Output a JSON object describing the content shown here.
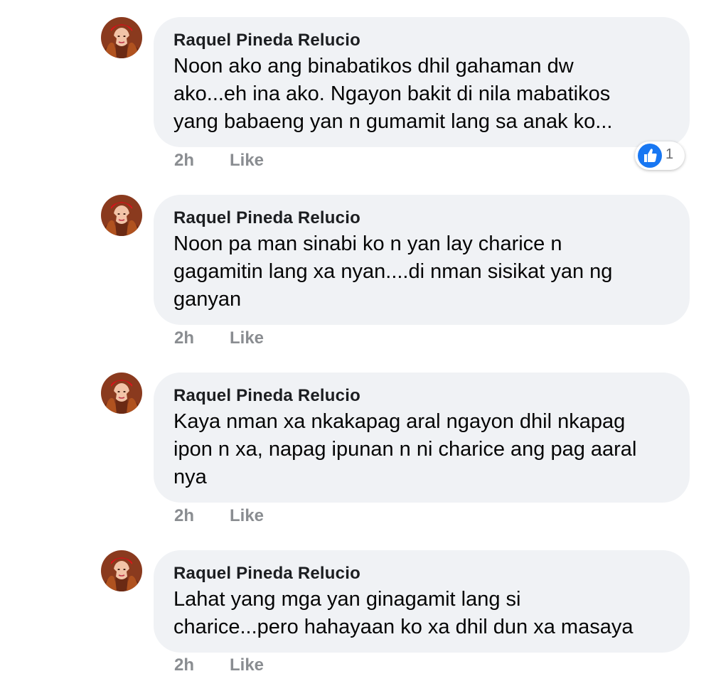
{
  "comments": [
    {
      "author": "Raquel Pineda Relucio",
      "text": "Noon ako ang binabatikos dhil gahaman dw\nako...eh ina ako. Ngayon bakit di nila mabatikos\nyang babaeng yan n gumamit lang sa anak ko...",
      "time": "2h",
      "like_label": "Like",
      "reaction_count": "1"
    },
    {
      "author": "Raquel Pineda Relucio",
      "text": "Noon pa man sinabi ko n yan lay charice n\ngagamitin lang xa nyan....di nman sisikat yan ng\nganyan",
      "time": "2h",
      "like_label": "Like"
    },
    {
      "author": "Raquel Pineda Relucio",
      "text": "Kaya nman xa nkakapag aral ngayon dhil nkapag\nipon n xa, napag ipunan n ni charice ang pag aaral\nnya",
      "time": "2h",
      "like_label": "Like"
    },
    {
      "author": "Raquel Pineda Relucio",
      "text": "Lahat yang mga yan ginagamit lang si\ncharice...pero hahayaan ko xa dhil dun xa masaya",
      "time": "2h",
      "like_label": "Like"
    }
  ],
  "colors": {
    "bubble": "#f0f2f5",
    "meta": "#8a8d91",
    "like_reaction": "#1877f2"
  },
  "icons": {
    "reaction": "thumbs-up-icon"
  }
}
